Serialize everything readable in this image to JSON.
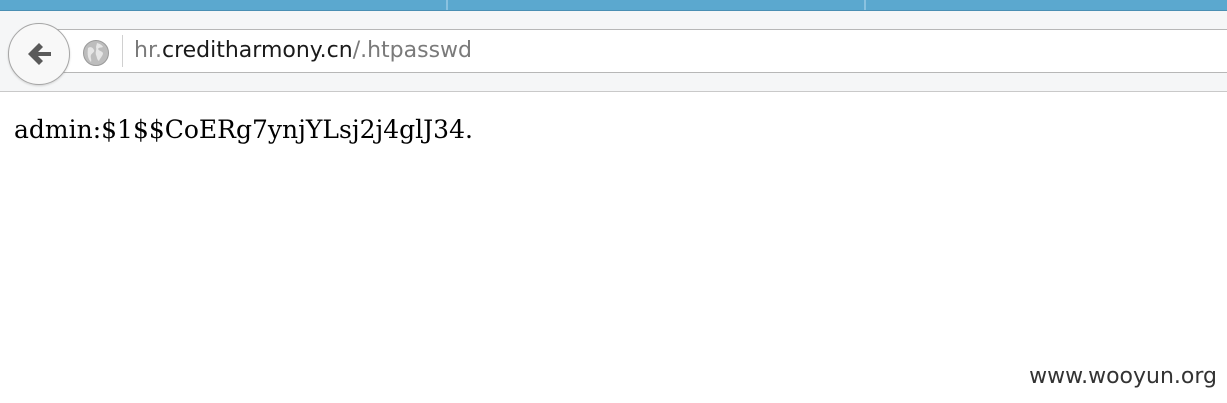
{
  "browser": {
    "address_bar": {
      "scheme_prefix": "hr.",
      "domain": "creditharmony.cn",
      "path": "/.htpasswd"
    },
    "icons": {
      "back": "back-arrow-icon",
      "site_identity": "globe-icon"
    },
    "colors": {
      "tab_strip": "#5ba8cf",
      "toolbar_bg": "#f5f6f7"
    }
  },
  "content": {
    "text": "admin:$1$$CoERg7ynjYLsj2j4glJ34."
  },
  "watermark": {
    "text": "www.wooyun.org"
  }
}
